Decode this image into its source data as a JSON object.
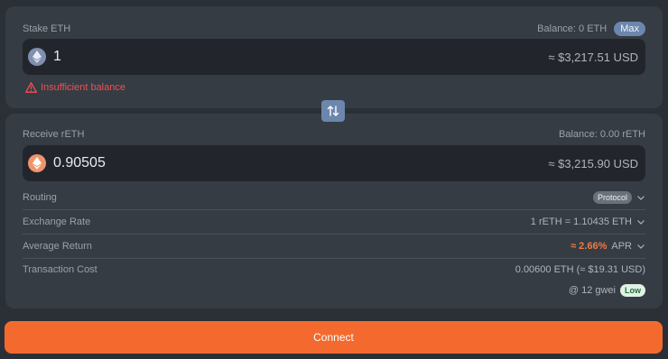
{
  "stake": {
    "label": "Stake ETH",
    "balance": "Balance: 0 ETH",
    "max_label": "Max",
    "amount": "1",
    "usd": "≈ $3,217.51 USD",
    "error": "Insufficient balance",
    "token_icon": "eth-icon"
  },
  "receive": {
    "label": "Receive rETH",
    "balance": "Balance: 0.00 rETH",
    "amount": "0.90505",
    "usd": "≈ $3,215.90 USD",
    "token_icon": "reth-icon"
  },
  "details": {
    "routing_label": "Routing",
    "routing_value": "Protocol",
    "rate_label": "Exchange Rate",
    "rate_value": "1 rETH = 1.10435 ETH",
    "return_label": "Average Return",
    "return_value": "≈ 2.66%",
    "return_unit": "APR",
    "cost_label": "Transaction Cost",
    "cost_value": "0.00600 ETH (≈ $19.31 USD)",
    "gas_value": "@ 12 gwei",
    "gas_badge": "Low"
  },
  "connect_label": "Connect",
  "colors": {
    "accent": "#f46a2e",
    "max_button": "#6c86ad",
    "error": "#ef5050",
    "apr": "#f07a3e"
  }
}
